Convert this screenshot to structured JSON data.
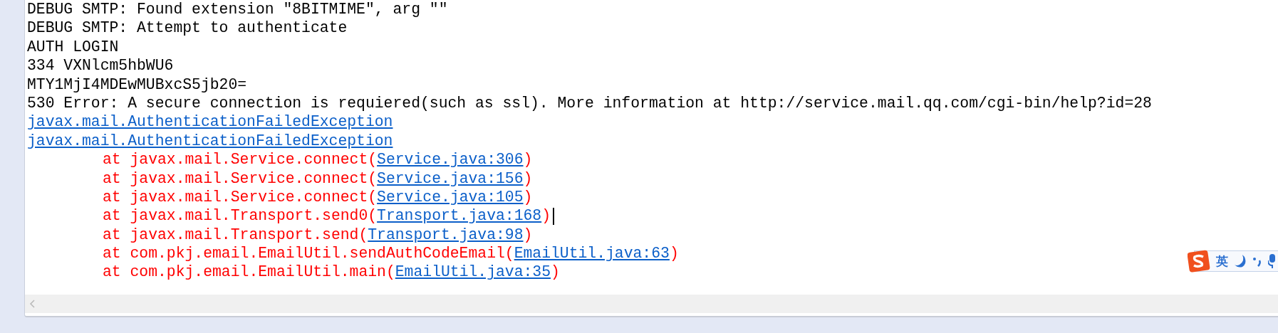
{
  "console": {
    "lines": [
      {
        "kind": "plain",
        "text": "DEBUG SMTP: Found extension \"8BITMIME\", arg \"\""
      },
      {
        "kind": "plain",
        "text": "DEBUG SMTP: Attempt to authenticate"
      },
      {
        "kind": "plain",
        "text": "AUTH LOGIN"
      },
      {
        "kind": "plain",
        "text": "334 VXNlcm5hbWU6"
      },
      {
        "kind": "plain",
        "text": "MTY1MjI4MDEwMUBxcS5jb20="
      },
      {
        "kind": "plain",
        "text": "530 Error: A secure connection is requiered(such as ssl). More information at http://service.mail.qq.com/cgi-bin/help?id=28"
      },
      {
        "kind": "link",
        "text": "javax.mail.AuthenticationFailedException"
      },
      {
        "kind": "link",
        "text": "javax.mail.AuthenticationFailedException"
      },
      {
        "kind": "frame",
        "text": "at javax.mail.Service.connect(",
        "link": "Service.java:306",
        "close": ")",
        "caret": false
      },
      {
        "kind": "frame",
        "text": "at javax.mail.Service.connect(",
        "link": "Service.java:156",
        "close": ")",
        "caret": false
      },
      {
        "kind": "frame",
        "text": "at javax.mail.Service.connect(",
        "link": "Service.java:105",
        "close": ")",
        "caret": false
      },
      {
        "kind": "frame",
        "text": "at javax.mail.Transport.send0(",
        "link": "Transport.java:168",
        "close": ")",
        "caret": true
      },
      {
        "kind": "frame",
        "text": "at javax.mail.Transport.send(",
        "link": "Transport.java:98",
        "close": ")",
        "caret": false
      },
      {
        "kind": "frame",
        "text": "at com.pkj.email.EmailUtil.sendAuthCodeEmail(",
        "link": "EmailUtil.java:63",
        "close": ")",
        "caret": false
      },
      {
        "kind": "frame",
        "text": "at com.pkj.email.EmailUtil.main(",
        "link": "EmailUtil.java:35",
        "close": ")",
        "caret": false
      }
    ]
  },
  "ime_toolbar": {
    "mode": "英"
  }
}
